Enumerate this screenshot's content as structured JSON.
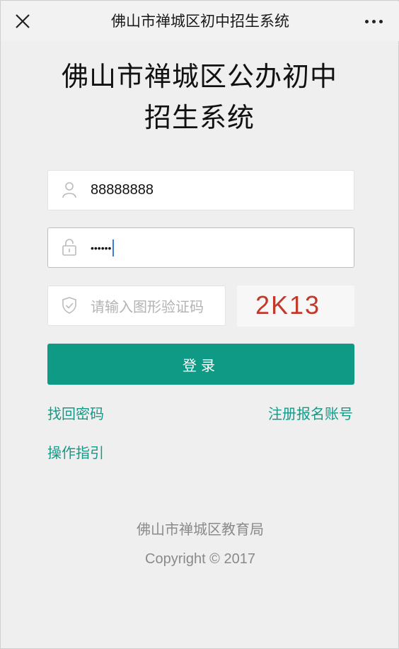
{
  "topbar": {
    "title": "佛山市禅城区初中招生系统"
  },
  "heading": {
    "line1": "佛山市禅城区公办初中",
    "line2": "招生系统"
  },
  "form": {
    "username_value": "88888888",
    "password_value": "••••••",
    "captcha_placeholder": "请输入图形验证码",
    "captcha_code": "2K13",
    "login_label": "登录"
  },
  "links": {
    "forgot_password": "找回密码",
    "register_account": "注册报名账号",
    "user_guide": "操作指引"
  },
  "footer": {
    "organization": "佛山市禅城区教育局",
    "copyright": "Copyright © 2017"
  },
  "colors": {
    "accent": "#0f9a86",
    "link": "#139a88",
    "background": "#efefef",
    "captcha_text": "#c0392b"
  },
  "icons": {
    "close": "close-icon",
    "more": "more-icon",
    "user": "user-icon",
    "lock": "lock-icon",
    "shield": "shield-icon"
  }
}
